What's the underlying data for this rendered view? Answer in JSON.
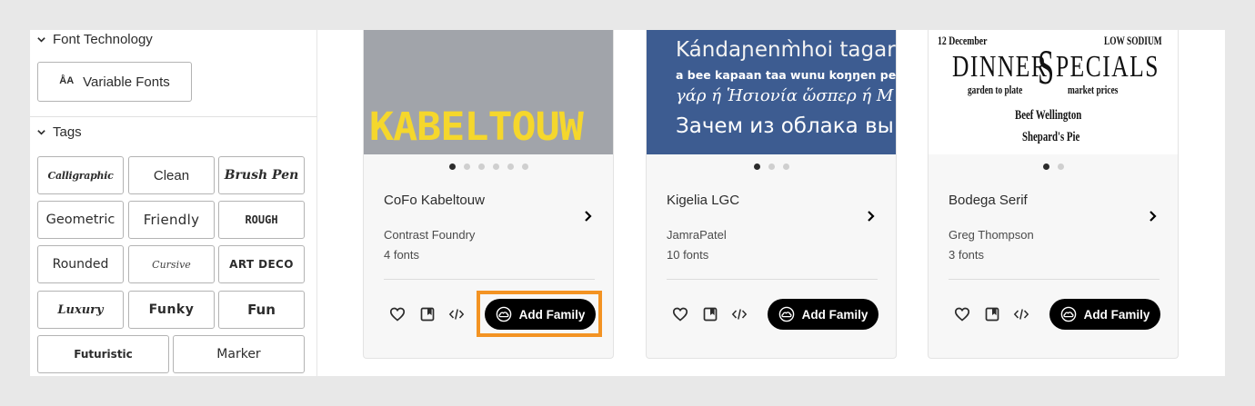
{
  "sidebar": {
    "font_technology": {
      "label": "Font Technology",
      "variable_fonts": "Variable Fonts",
      "variable_icon": "ÅA"
    },
    "tags": {
      "label": "Tags",
      "items": [
        "Calligraphic",
        "Clean",
        "Brush Pen",
        "Geometric",
        "Friendly",
        "ROUGH",
        "Rounded",
        "Cursive",
        "ART DECO",
        "Luxury",
        "Funky",
        "Fun",
        "Futuristic",
        "Marker"
      ]
    }
  },
  "cards": [
    {
      "name": "CoFo Kabeltouw",
      "foundry": "Contrast Foundry",
      "count": "4 fonts",
      "add_label": "Add Family",
      "dots": 6,
      "active_dot": 0,
      "preview": {
        "text": "KABELTOUW",
        "bg": "#a1a4aa",
        "color": "#f5d72c"
      },
      "highlighted": true
    },
    {
      "name": "Kigelia LGC",
      "foundry": "JamraPatel",
      "count": "10 fonts",
      "add_label": "Add Family",
      "dots": 3,
      "active_dot": 0,
      "preview": {
        "bg": "#3d5c91",
        "lines": [
          "Kándaɲenm̀hoi tagara",
          "a bee kapaan taa wunu koŋŋen pee l",
          "γάρ ή Ἡσιονία ὥσπερ ή Μ",
          "Зачем из облака вы"
        ]
      },
      "highlighted": false
    },
    {
      "name": "Bodega Serif",
      "foundry": "Greg Thompson",
      "count": "3 fonts",
      "add_label": "Add Family",
      "dots": 2,
      "active_dot": 0,
      "preview": {
        "bg": "#ffffff",
        "date": "12 December",
        "low_sodium": "LOW SODIUM",
        "dinner": "DINNER",
        "specials": "PECIALS",
        "big_s": "S",
        "garden": "garden to plate",
        "market": "market prices",
        "dish1": "Beef Wellington",
        "dish2": "Shepard's Pie"
      },
      "highlighted": false
    }
  ],
  "icons": [
    "chevron-down-icon",
    "heart-icon",
    "bookmark-icon",
    "code-icon",
    "creative-cloud-icon",
    "chevron-right-icon"
  ],
  "colors": {
    "accent_highlight": "#f39323",
    "button_bg": "#000000",
    "page_bg": "#e8e8e8"
  }
}
